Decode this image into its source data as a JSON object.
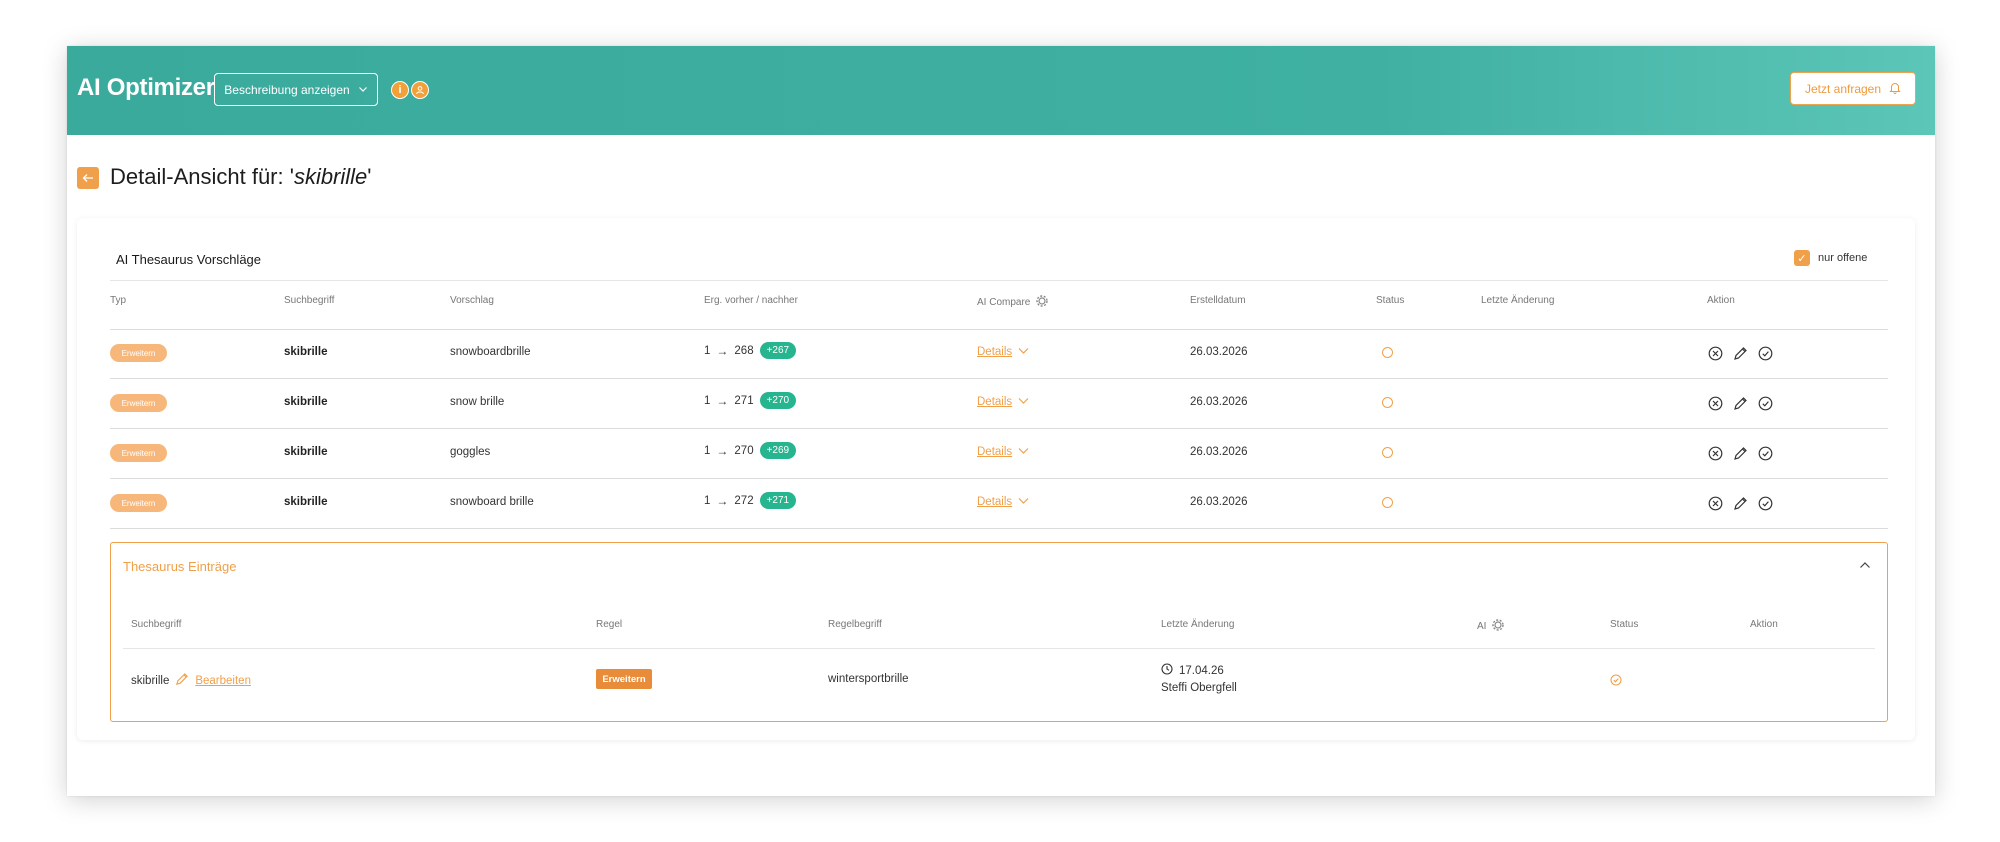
{
  "header": {
    "app_title": "AI Optimizer",
    "description_button": "Beschreibung anzeigen",
    "info_icon": "info-icon",
    "team_icon": "users-icon",
    "request_button": "Jetzt anfragen"
  },
  "page": {
    "title_prefix": "Detail-Ansicht für: '",
    "title_term": "skibrille",
    "title_suffix": "'"
  },
  "suggestions": {
    "title": "AI Thesaurus Vorschläge",
    "filter_label": "nur offene",
    "filter_checked": true,
    "columns": [
      "Typ",
      "Suchbegriff",
      "Vorschlag",
      "Erg. vorher / nachher",
      "AI Compare",
      "Erstelldatum",
      "Status",
      "Letzte Änderung",
      "Aktion"
    ],
    "rows": [
      {
        "type": "Erweitern",
        "term": "skibrille",
        "suggestion": "snowboardbrille",
        "before": "1",
        "after": "268",
        "delta": "+267",
        "compare": "Details",
        "created": "26.03.2026",
        "last_change": ""
      },
      {
        "type": "Erweitern",
        "term": "skibrille",
        "suggestion": "snow brille",
        "before": "1",
        "after": "271",
        "delta": "+270",
        "compare": "Details",
        "created": "26.03.2026",
        "last_change": ""
      },
      {
        "type": "Erweitern",
        "term": "skibrille",
        "suggestion": "goggles",
        "before": "1",
        "after": "270",
        "delta": "+269",
        "compare": "Details",
        "created": "26.03.2026",
        "last_change": ""
      },
      {
        "type": "Erweitern",
        "term": "skibrille",
        "suggestion": "snowboard brille",
        "before": "1",
        "after": "272",
        "delta": "+271",
        "compare": "Details",
        "created": "26.03.2026",
        "last_change": ""
      }
    ]
  },
  "thesaurus": {
    "title": "Thesaurus Einträge",
    "columns": [
      "Suchbegriff",
      "Regel",
      "Regelbegriff",
      "Letzte Änderung",
      "AI",
      "Status",
      "Aktion"
    ],
    "entry": {
      "term": "skibrille",
      "edit_label": "Bearbeiten",
      "rule": "Erweitern",
      "rule_term": "wintersportbrille",
      "changed_date": "17.04.26",
      "changed_by": "Steffi Obergfell"
    }
  },
  "colors": {
    "header_teal": "#3aaa9c",
    "accent_orange": "#f0a04a",
    "delta_green": "#27b58f"
  }
}
